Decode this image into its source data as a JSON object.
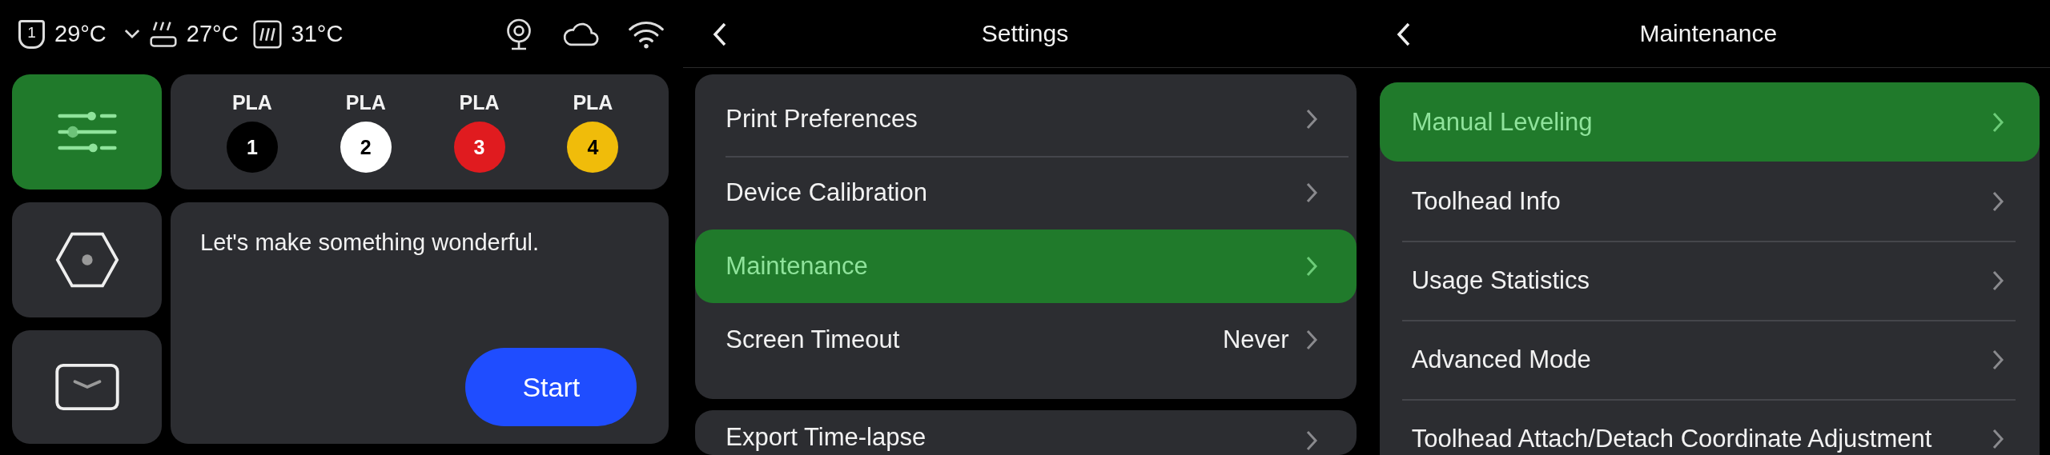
{
  "home": {
    "status_bar": {
      "extruder_number": "1",
      "nozzle_temp": "29°C",
      "bed_temp": "27°C",
      "chamber_temp": "31°C"
    },
    "tiles": [
      {
        "kind": "controls",
        "selected": true
      },
      {
        "kind": "nozzle",
        "selected": false
      },
      {
        "kind": "tray",
        "selected": false
      }
    ],
    "filaments": [
      {
        "label": "PLA",
        "slot": "1",
        "color": "#000000"
      },
      {
        "label": "PLA",
        "slot": "2",
        "color": "#ffffff"
      },
      {
        "label": "PLA",
        "slot": "3",
        "color": "#e01b1f"
      },
      {
        "label": "PLA",
        "slot": "4",
        "color": "#f0bc0a"
      }
    ],
    "message": "Let's make something wonderful.",
    "start_button": "Start"
  },
  "settings": {
    "title": "Settings",
    "groups": [
      {
        "items": [
          {
            "label": "Print Preferences",
            "selected": false
          },
          {
            "label": "Device Calibration",
            "selected": false
          },
          {
            "label": "Maintenance",
            "selected": true
          },
          {
            "label": "Screen Timeout",
            "value": "Never",
            "selected": false
          }
        ]
      },
      {
        "items": [
          {
            "label": "Export Time-lapse",
            "selected": false
          }
        ]
      }
    ]
  },
  "maintenance": {
    "title": "Maintenance",
    "items": [
      {
        "label": "Manual Leveling",
        "selected": true
      },
      {
        "label": "Toolhead Info",
        "selected": false
      },
      {
        "label": "Usage Statistics",
        "selected": false
      },
      {
        "label": "Advanced Mode",
        "selected": false
      },
      {
        "label": "Toolhead Attach/Detach Coordinate Adjustment",
        "selected": false
      }
    ]
  }
}
